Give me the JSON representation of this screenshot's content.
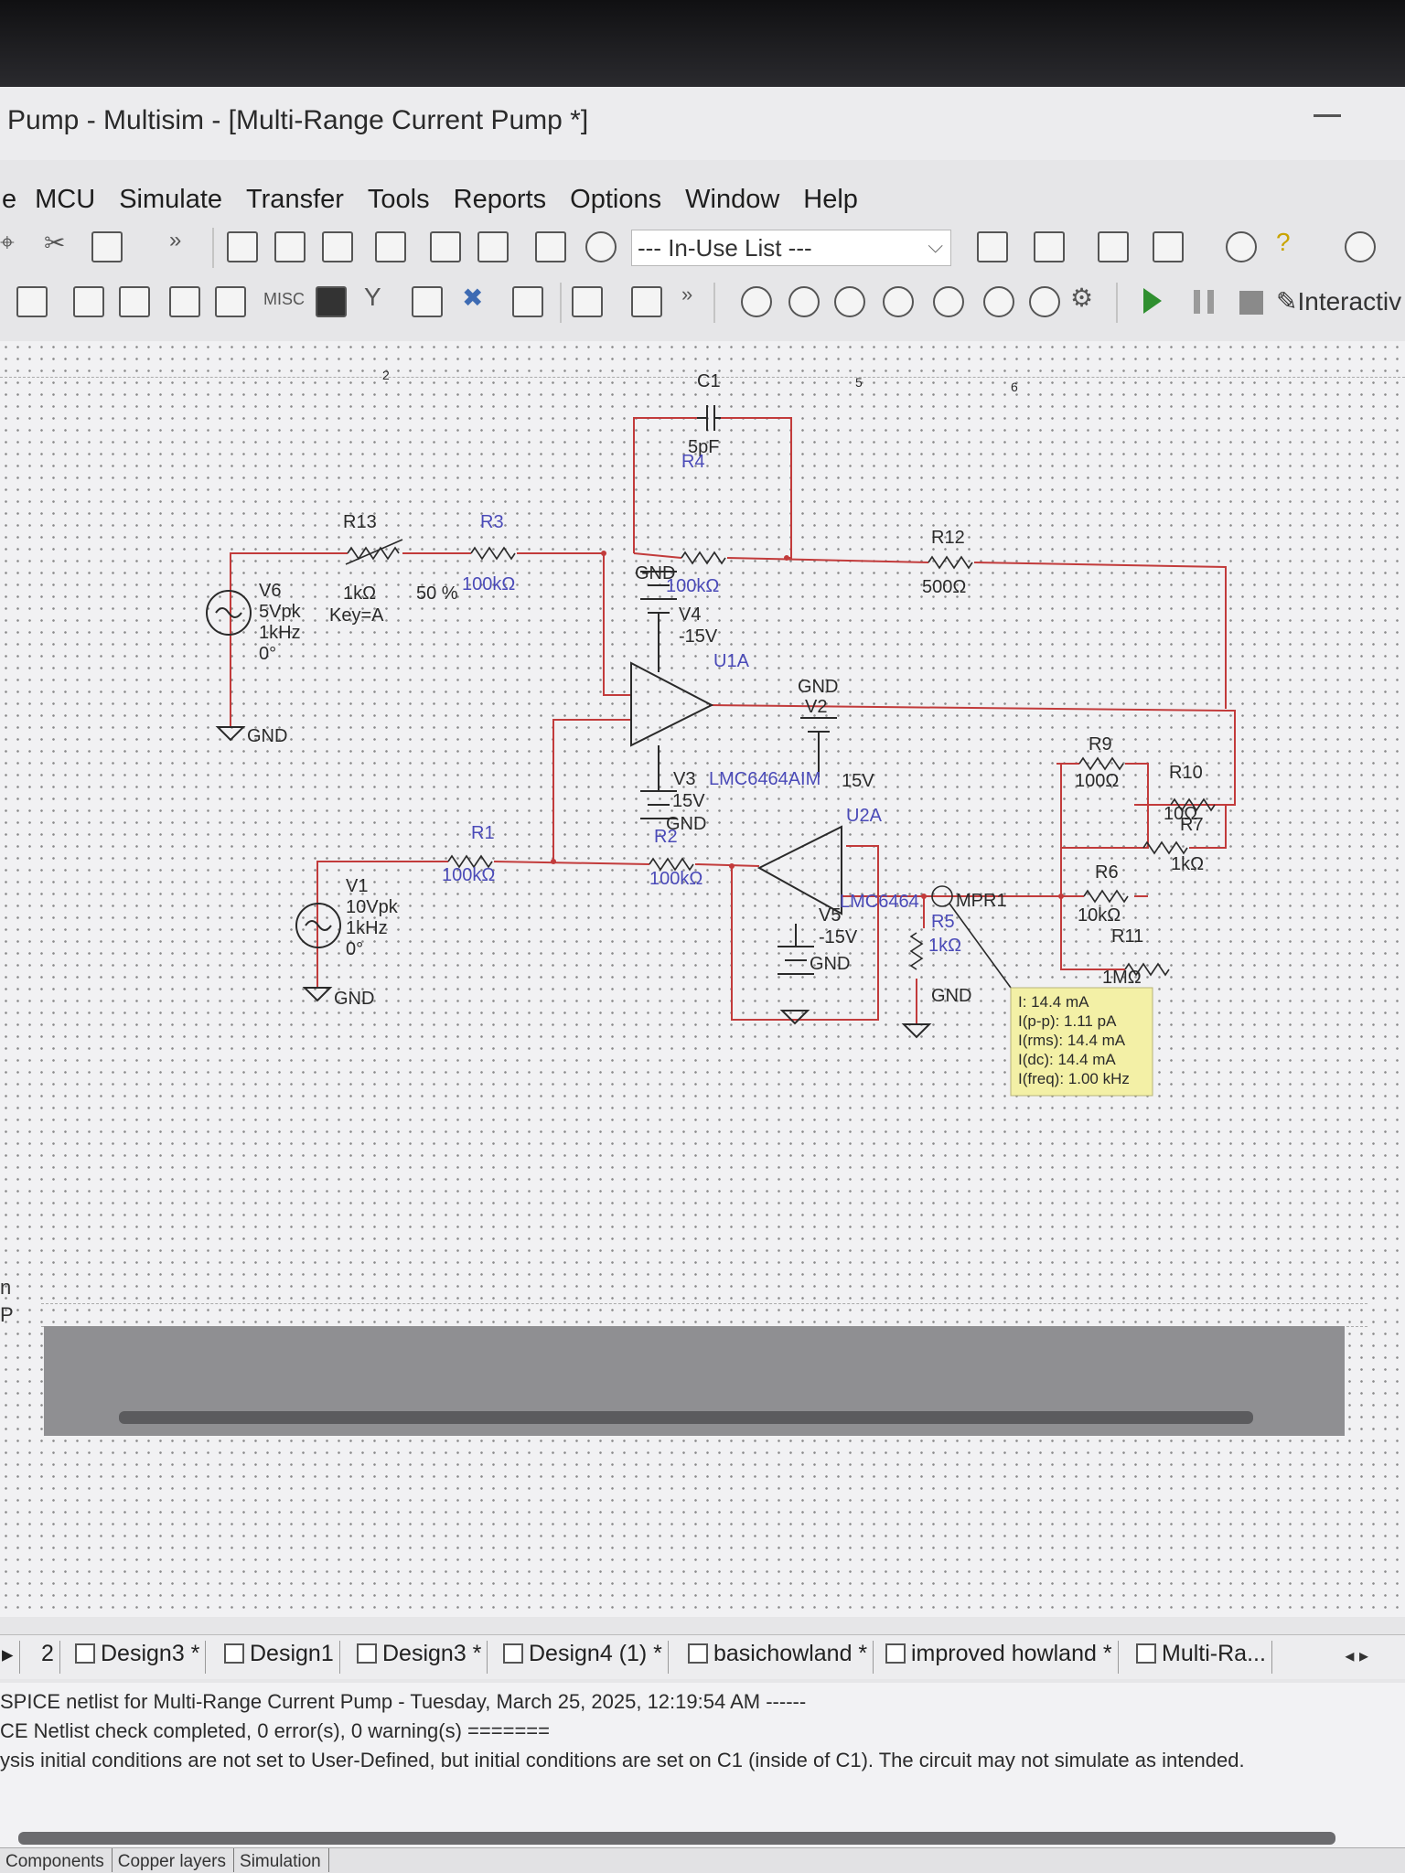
{
  "window": {
    "title": "Pump - Multisim - [Multi-Range Current Pump *]"
  },
  "menu": {
    "items": [
      "e",
      "MCU",
      "Simulate",
      "Transfer",
      "Tools",
      "Reports",
      "Options",
      "Window",
      "Help"
    ]
  },
  "toolbar": {
    "inuse_list": "--- In-Use List ---",
    "interactive": "Interactiv",
    "misc_label": "MISC",
    "overflow": "»"
  },
  "schematic": {
    "components": {
      "V6": {
        "name": "V6",
        "amp": "5Vpk",
        "freq": "1kHz",
        "phase": "0°"
      },
      "V1": {
        "name": "V1",
        "amp": "10Vpk",
        "freq": "1kHz",
        "phase": "0°"
      },
      "R13": {
        "name": "R13",
        "value": "1kΩ",
        "pct": "50 %",
        "key": "Key=A"
      },
      "R3": {
        "name": "R3",
        "value": "100kΩ"
      },
      "R4": {
        "name": "R4",
        "value": "100kΩ"
      },
      "C1": {
        "name": "C1",
        "value": "5pF"
      },
      "R12": {
        "name": "R12",
        "value": "500Ω"
      },
      "V4": {
        "name": "V4",
        "value": "-15V"
      },
      "U1A": {
        "name": "U1A",
        "part": "LMC6464AIM"
      },
      "V2": {
        "name": "V2",
        "value": "15V"
      },
      "V3": {
        "name": "V3",
        "value": "15V"
      },
      "R1": {
        "name": "R1",
        "value": "100kΩ"
      },
      "R2": {
        "name": "R2",
        "value": "100kΩ"
      },
      "U2A": {
        "name": "U2A",
        "part": "LMC6464"
      },
      "V5": {
        "name": "V5",
        "value": "-15V"
      },
      "R5": {
        "name": "R5",
        "value": "1kΩ"
      },
      "MPR1": {
        "name": "MPR1"
      },
      "R9": {
        "name": "R9",
        "value": "100Ω"
      },
      "R10": {
        "name": "R10",
        "value": "10Ω"
      },
      "R7": {
        "name": "R7",
        "value": "1kΩ"
      },
      "R6": {
        "name": "R6",
        "value": "10kΩ"
      },
      "R11": {
        "name": "R11",
        "value": "1MΩ"
      },
      "gnd": "GND"
    },
    "probe": {
      "I": "I: 14.4 mA",
      "Ipp": "I(p-p): 1.11 pA",
      "Irms": "I(rms): 14.4 mA",
      "Idc": "I(dc): 14.4 mA",
      "Ifreq": "I(freq): 1.00 kHz"
    },
    "ruler_marks": [
      "2",
      "5",
      "6"
    ]
  },
  "tabs": [
    {
      "label": "2"
    },
    {
      "label": "Design3 *"
    },
    {
      "label": "Design1"
    },
    {
      "label": "Design3 *"
    },
    {
      "label": "Design4 (1) *"
    },
    {
      "label": "basichowland *"
    },
    {
      "label": "improved howland *"
    },
    {
      "label": "Multi-Ra..."
    }
  ],
  "output": {
    "line1": "SPICE netlist for Multi-Range Current Pump - Tuesday, March 25, 2025, 12:19:54 AM ------",
    "line2": "CE Netlist check completed, 0 error(s), 0 warning(s) =======",
    "line3": "ysis initial conditions are not set to User-Defined, but initial conditions are set on C1 (inside of C1). The circuit may not simulate as intended."
  },
  "bottom_tabs": [
    "Components",
    "Copper layers",
    "Simulation"
  ],
  "left_edge": {
    "a": "n",
    "b": "P"
  },
  "colors": {
    "wire": "#c23b3b",
    "component": "#2a2a2a",
    "label_blue": "#4a4ab8",
    "probe_bg": "#f3f0a6"
  }
}
